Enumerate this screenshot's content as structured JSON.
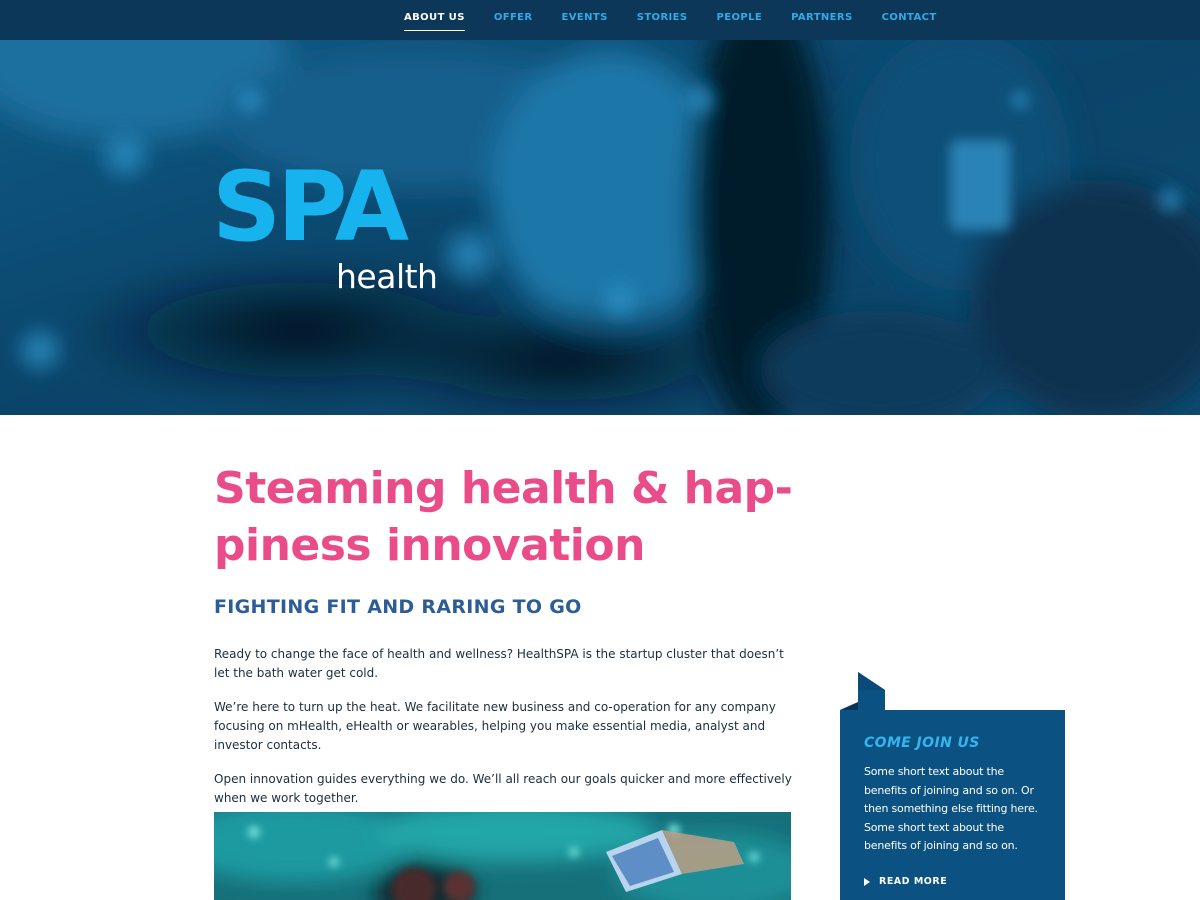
{
  "nav": {
    "items": [
      {
        "label": "ABOUT US",
        "active": true
      },
      {
        "label": "OFFER",
        "active": false
      },
      {
        "label": "EVENTS",
        "active": false
      },
      {
        "label": "STORIES",
        "active": false
      },
      {
        "label": "PEOPLE",
        "active": false
      },
      {
        "label": "PARTNERS",
        "active": false
      },
      {
        "label": "CONTACT",
        "active": false
      }
    ]
  },
  "hero": {
    "logo_primary": "SPA",
    "logo_secondary": "health"
  },
  "main": {
    "headline": "Steaming health & hap-piness innovation",
    "subheading": "FIGHTING FIT AND RARING TO GO",
    "paragraphs": [
      "Ready to change the face of health and wellness? HealthSPA is the startup cluster that doesn’t let the bath water get cold.",
      "We’re here to turn up the heat. We facilitate new business and co-operation for any company focusing on mHealth, eHealth or wearables, helping you make essential media, analyst and investor contacts.",
      "Open innovation guides everything we do. We’ll all reach our goals quicker and more effectively when we work together."
    ]
  },
  "sidebar": {
    "card_title": "COME JOIN US",
    "card_text": "Some short text about the benefits of joining and so on. Or then something else fitting here. Some short text about the benefits of joining and so on.",
    "read_more": "READ MORE"
  },
  "colors": {
    "nav_bg": "#0d3758",
    "nav_link": "#35a9e5",
    "headline": "#ea4c8a",
    "subheading": "#2d5d96",
    "card_bg": "#0b5283",
    "card_title": "#35b5ef",
    "logo_blue": "#16b3ef"
  }
}
